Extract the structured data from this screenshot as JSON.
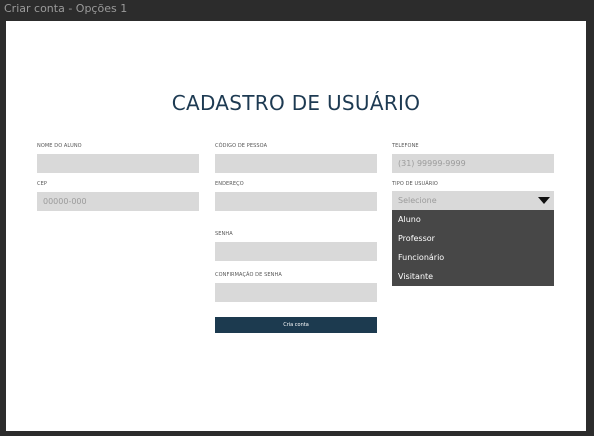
{
  "window": {
    "title": "Criar conta - Opções 1"
  },
  "form": {
    "title": "CADASTRO DE USUÁRIO",
    "fields": {
      "nome": {
        "label": "NOME DO ALUNO",
        "placeholder": ""
      },
      "codigo": {
        "label": "CÓDIGO DE PESSOA",
        "placeholder": ""
      },
      "telefone": {
        "label": "TELEFONE",
        "placeholder": "(31) 99999-9999"
      },
      "cep": {
        "label": "CEP",
        "placeholder": "00000-000"
      },
      "endereco": {
        "label": "ENDEREÇO",
        "placeholder": ""
      },
      "tipo": {
        "label": "TIPO DE USUÁRIO",
        "value": "Selecione"
      },
      "senha": {
        "label": "SENHA",
        "placeholder": ""
      },
      "confirmacao": {
        "label": "CONFIRMAÇÃO DE SENHA",
        "placeholder": ""
      }
    },
    "tipo_options": [
      "Aluno",
      "Professor",
      "Funcionário",
      "Visitante"
    ],
    "submit_label": "Cria conta"
  },
  "colors": {
    "title": "#1d3a52",
    "input_bg": "#d9d9d9",
    "dropdown_bg": "#474747",
    "button_bg": "#1c3a4f"
  }
}
